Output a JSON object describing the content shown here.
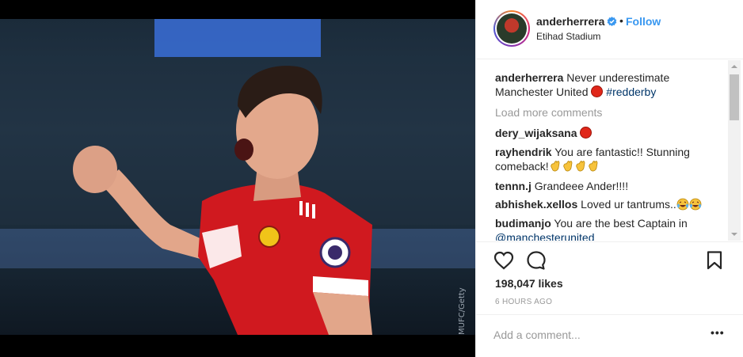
{
  "post": {
    "username": "anderherrera",
    "separator": "•",
    "follow_label": "Follow",
    "location": "Etihad Stadium",
    "photo_watermark": "©MUFC/Getty",
    "caption": {
      "user": "anderherrera",
      "text": "Never underestimate Manchester United",
      "hashtag": "#redderby"
    },
    "load_more_label": "Load more comments",
    "comments": [
      {
        "user": "dery_wijaksana",
        "text": ""
      },
      {
        "user": "rayhendrik",
        "text": "You are fantastic!! Stunning comeback!"
      },
      {
        "user": "tennn.j",
        "text": "Grandeee Ander!!!!"
      },
      {
        "user": "abhishek.xellos",
        "text": "Loved ur tantrums.."
      },
      {
        "user": "budimanjo",
        "text": "You are the best Captain in",
        "mention": "@manchesterunited"
      }
    ],
    "likes": "198,047 likes",
    "timestamp": "6 HOURS AGO",
    "add_comment_placeholder": "Add a comment...",
    "more_options_label": "•••"
  },
  "icons": {
    "like": "heart-icon",
    "comment": "speech-bubble-icon",
    "save": "bookmark-icon",
    "verified": "verified-badge-icon"
  },
  "colors": {
    "follow_blue": "#3897f0",
    "hashtag_navy": "#003569",
    "muted_gray": "#999999",
    "text_dark": "#262626"
  }
}
